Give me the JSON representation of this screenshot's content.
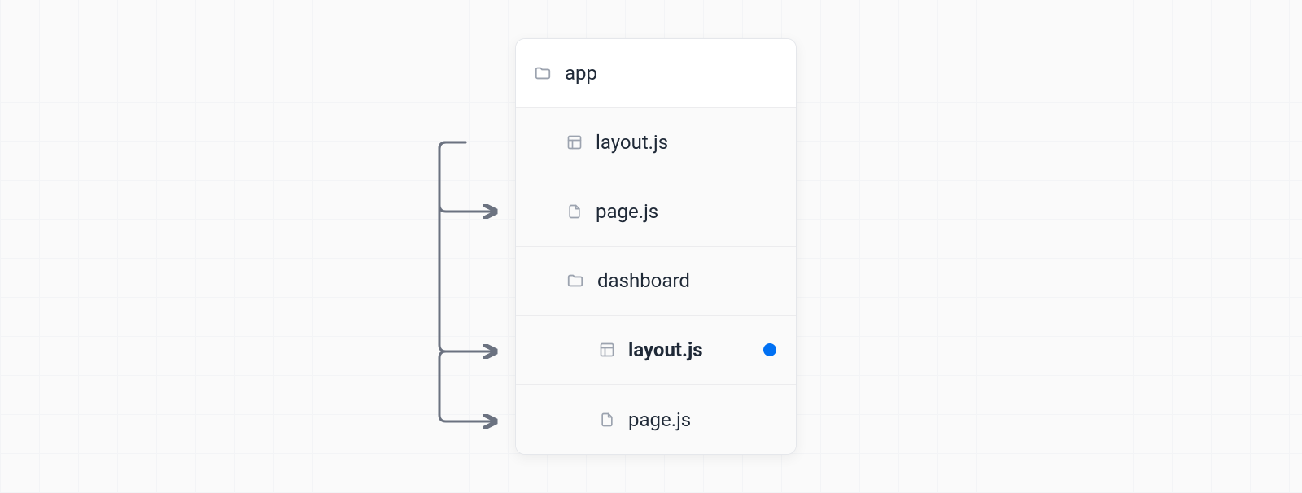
{
  "tree": {
    "root": "app",
    "items": [
      {
        "label": "layout.js",
        "icon": "layout",
        "indent": 1,
        "shaded": true
      },
      {
        "label": "page.js",
        "icon": "file",
        "indent": 1,
        "shaded": true
      },
      {
        "label": "dashboard",
        "icon": "folder",
        "indent": 1,
        "shaded": true
      },
      {
        "label": "layout.js",
        "icon": "layout",
        "indent": 2,
        "shaded": true,
        "bold": true,
        "active": true
      },
      {
        "label": "page.js",
        "icon": "file",
        "indent": 2,
        "shaded": true
      }
    ]
  },
  "colors": {
    "accent": "#0070f3",
    "icon": "#9ca3af",
    "border": "#e5e7eb"
  }
}
